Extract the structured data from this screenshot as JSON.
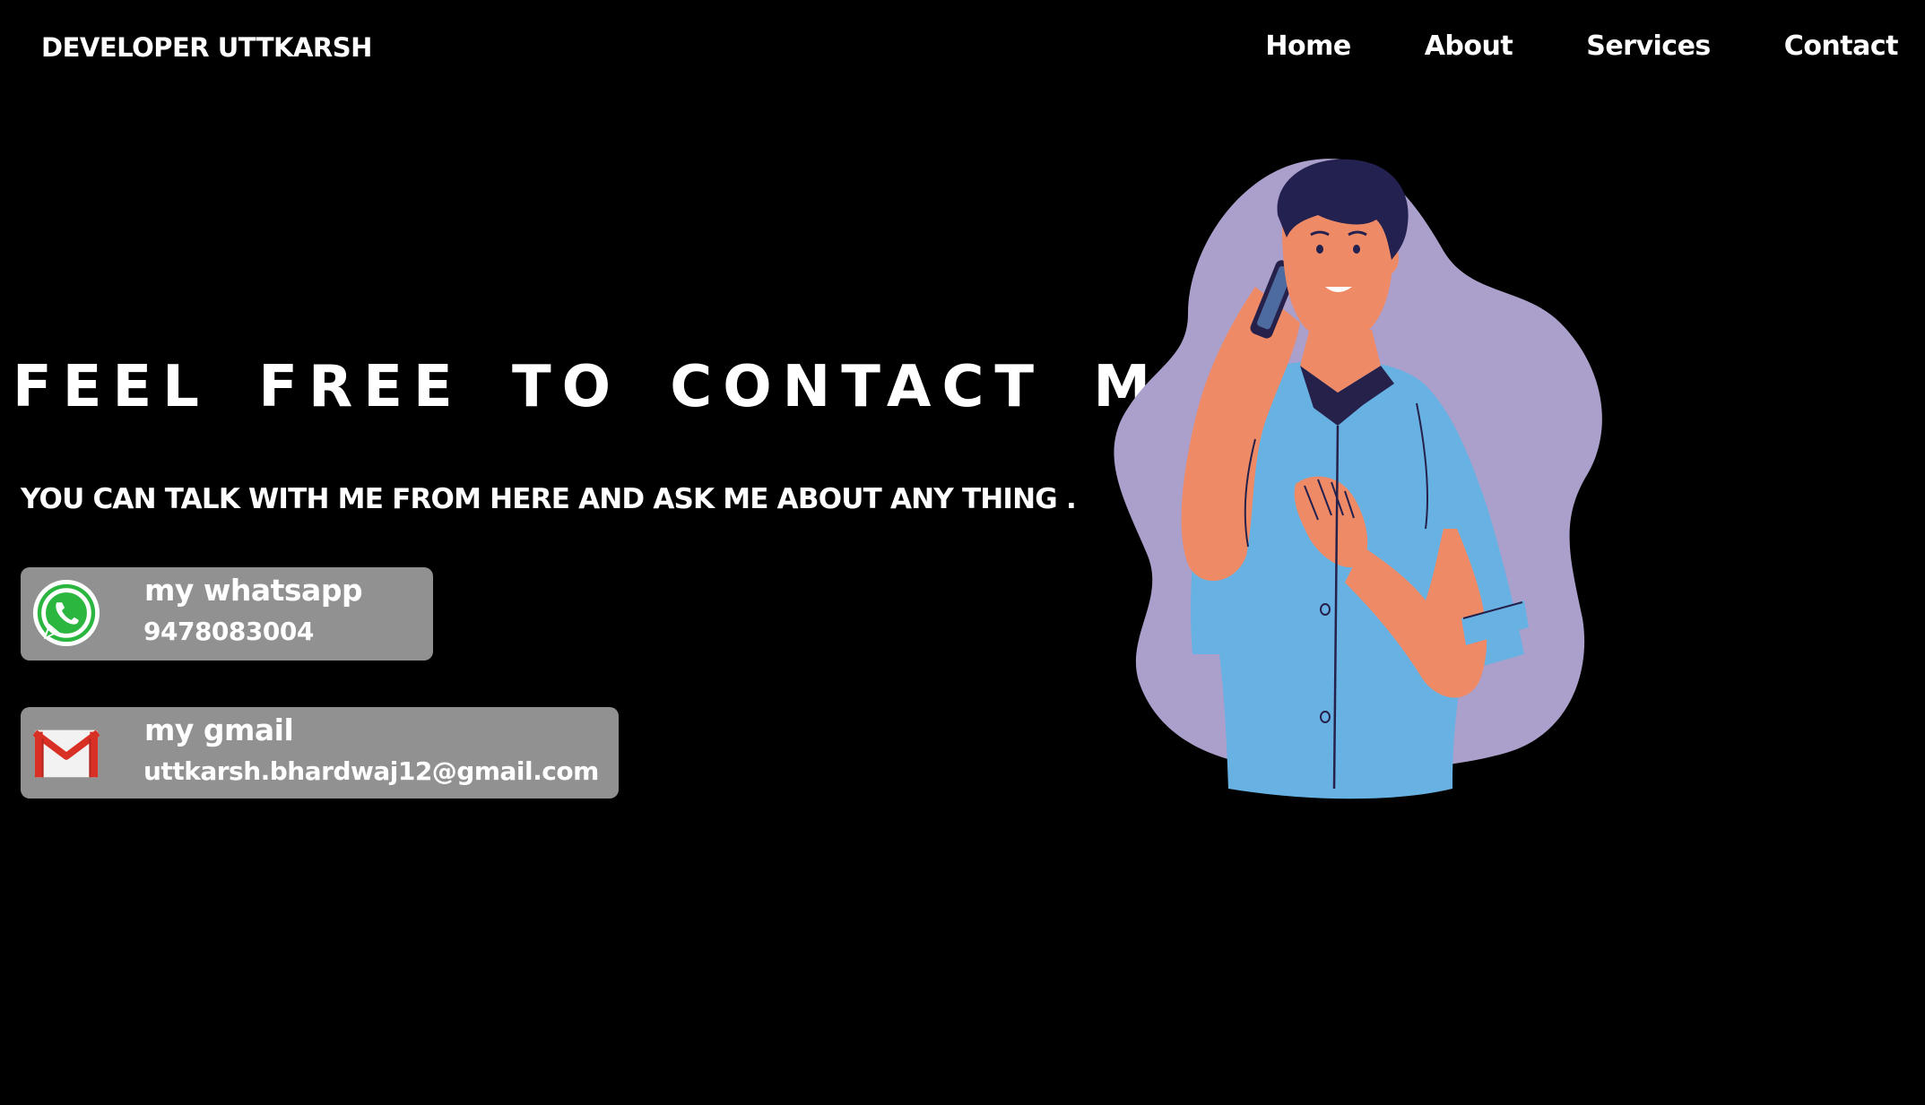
{
  "header": {
    "brand": "DEVELOPER UTTKARSH",
    "nav": [
      {
        "label": "Home"
      },
      {
        "label": "About"
      },
      {
        "label": "Services"
      },
      {
        "label": "Contact"
      }
    ]
  },
  "hero": {
    "headline": "FEEL FREE TO CONTACT ME",
    "subline": "YOU CAN TALK WITH ME FROM HERE AND ASK ME ABOUT ANY THING ."
  },
  "contacts": [
    {
      "title": "my whatsapp",
      "value": "9478083004",
      "icon": "whatsapp-icon"
    },
    {
      "title": "my gmail",
      "value": "uttkarsh.bhardwaj12@gmail.com",
      "icon": "gmail-icon"
    }
  ],
  "illustration": {
    "subject": "man-talking-on-phone",
    "colors": {
      "blob": "#ab9fcb",
      "shirt": "#68b2e3",
      "skin": "#ef8a66",
      "hair": "#23214f",
      "collar": "#25214b"
    }
  },
  "colors": {
    "background": "#000000",
    "text": "#ffffff",
    "card": "#919191",
    "whatsapp": "#2bb640",
    "gmail_red": "#d93025"
  }
}
